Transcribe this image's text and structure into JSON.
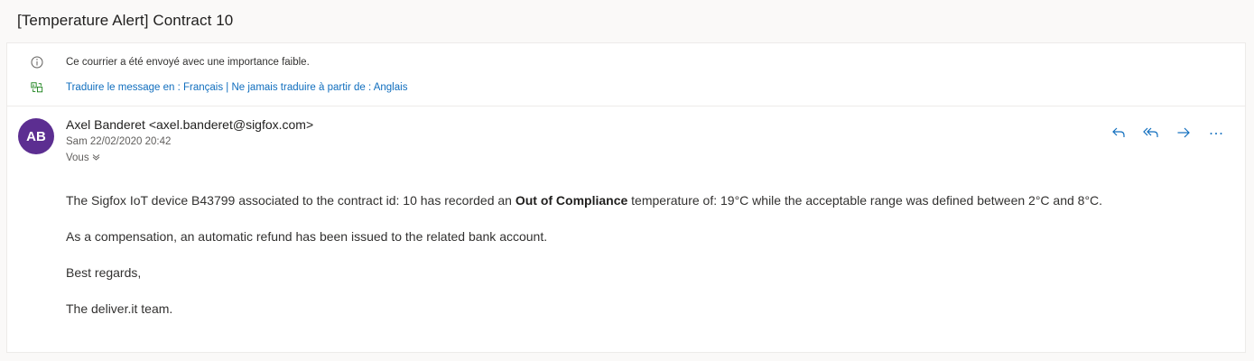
{
  "subject": "[Temperature Alert] Contract 10",
  "banner": {
    "importance_text": "Ce courrier a été envoyé avec une importance faible.",
    "translate_link": "Traduire le message en : Français",
    "separator": "|",
    "never_translate_link": "Ne jamais traduire à partir de : Anglais"
  },
  "message": {
    "avatar_initials": "AB",
    "avatar_color": "#5c2e91",
    "sender": "Axel Banderet <axel.banderet@sigfox.com>",
    "date": "Sam 22/02/2020 20:42",
    "to": "Vous",
    "body": {
      "p1_before": "The Sigfox IoT device B43799 associated to the contract id: 10 has recorded an ",
      "p1_bold": "Out of Compliance",
      "p1_after": " temperature of: 19°C while the acceptable range was defined between 2°C and 8°C.",
      "p2": "As a compensation, an automatic refund has been issued to the related bank account.",
      "p3": "Best regards,",
      "p4": "The deliver.it team."
    }
  },
  "actions": [
    {
      "icon": "reply-icon"
    },
    {
      "icon": "reply-all-icon"
    },
    {
      "icon": "forward-icon"
    },
    {
      "icon": "more-icon"
    }
  ],
  "accent_color": "#106ebe"
}
